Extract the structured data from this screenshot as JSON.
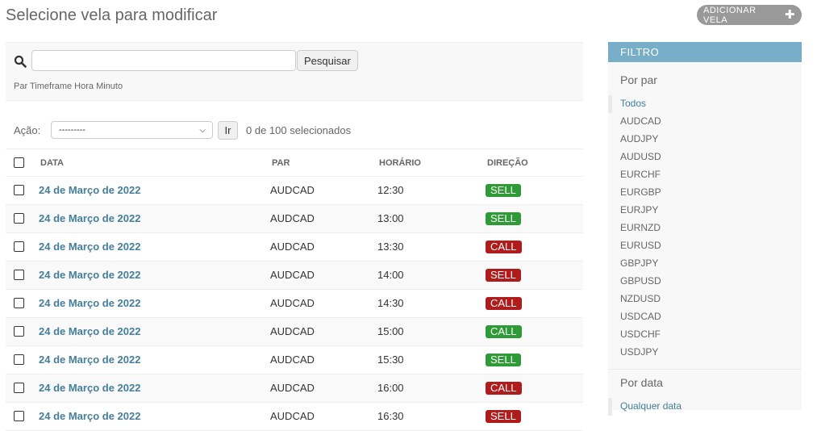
{
  "header": {
    "title": "Selecione vela para modificar",
    "add_button_label": "ADICIONAR VELA",
    "add_icon": "plus-icon"
  },
  "search": {
    "value": "",
    "placeholder": "",
    "button_label": "Pesquisar",
    "help_text": "Par Timeframe Hora Minuto"
  },
  "actions": {
    "label": "Ação:",
    "selected_option": "---------",
    "go_label": "Ir",
    "selected_count": "0 de 100 selecionados"
  },
  "table": {
    "columns": [
      "DATA",
      "PAR",
      "HORÁRIO",
      "DIREÇÃO"
    ],
    "rows": [
      {
        "data": "24 de Março de 2022",
        "par": "AUDCAD",
        "horario": "12:30",
        "direcao": "SELL"
      },
      {
        "data": "24 de Março de 2022",
        "par": "AUDCAD",
        "horario": "13:00",
        "direcao": "SELL"
      },
      {
        "data": "24 de Março de 2022",
        "par": "AUDCAD",
        "horario": "13:30",
        "direcao": "CALL"
      },
      {
        "data": "24 de Março de 2022",
        "par": "AUDCAD",
        "horario": "14:00",
        "direcao": "SELL"
      },
      {
        "data": "24 de Março de 2022",
        "par": "AUDCAD",
        "horario": "14:30",
        "direcao": "CALL"
      },
      {
        "data": "24 de Março de 2022",
        "par": "AUDCAD",
        "horario": "15:00",
        "direcao": "CALL"
      },
      {
        "data": "24 de Março de 2022",
        "par": "AUDCAD",
        "horario": "15:30",
        "direcao": "SELL"
      },
      {
        "data": "24 de Março de 2022",
        "par": "AUDCAD",
        "horario": "16:00",
        "direcao": "CALL"
      },
      {
        "data": "24 de Março de 2022",
        "par": "AUDCAD",
        "horario": "16:30",
        "direcao": "SELL"
      }
    ],
    "badge_colors": {
      "SELL_green": "#2e9b36",
      "red": "#b01c1c"
    }
  },
  "filter": {
    "header": "FILTRO",
    "by_par_title": "Por par",
    "par_options": [
      "Todos",
      "AUDCAD",
      "AUDJPY",
      "AUDUSD",
      "EURCHF",
      "EURGBP",
      "EURJPY",
      "EURNZD",
      "EURUSD",
      "GBPJPY",
      "GBPUSD",
      "NZDUSD",
      "USDCAD",
      "USDCHF",
      "USDJPY"
    ],
    "by_date_title": "Por data",
    "date_options": [
      "Qualquer data"
    ]
  },
  "colors": {
    "link": "#447e9b",
    "filter_header": "#79aec8",
    "add_button": "#999999"
  }
}
